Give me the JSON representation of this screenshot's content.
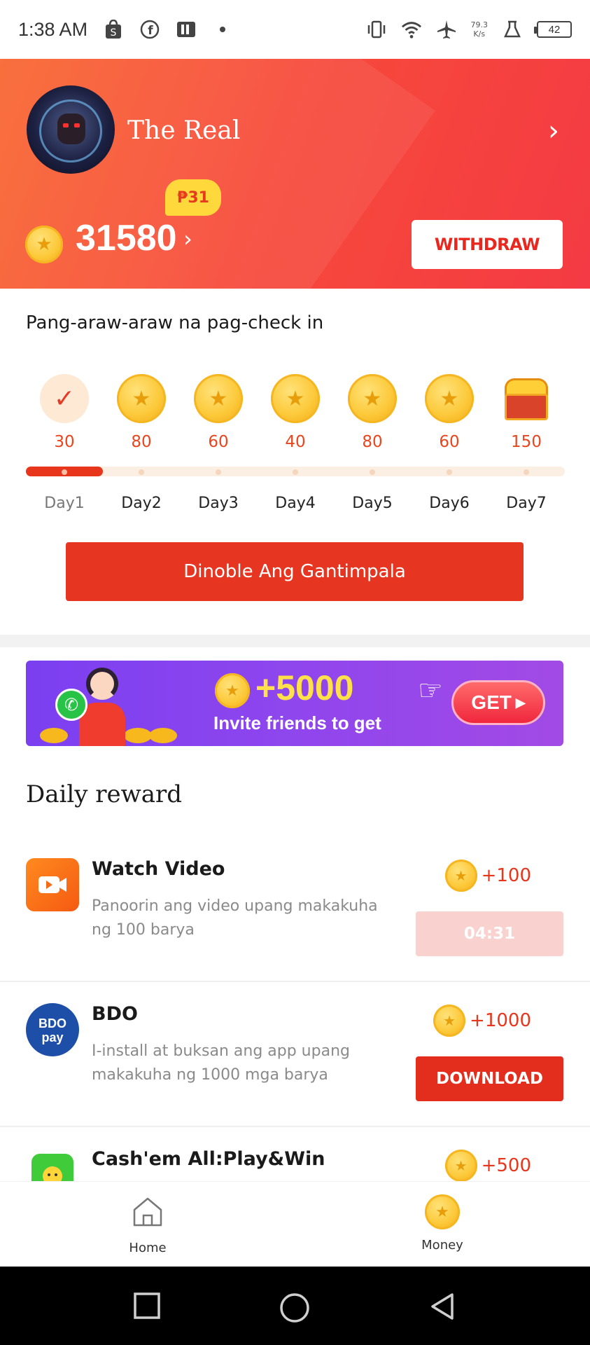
{
  "status_bar": {
    "time": "1:38 AM",
    "net_speed_value": "79.3",
    "net_speed_unit": "K/s",
    "battery": "42"
  },
  "profile": {
    "name": "The Real",
    "peso_badge": "₱31",
    "coin_balance": "31580",
    "withdraw_label": "WITHDRAW"
  },
  "checkin": {
    "title": "Pang-araw-araw na pag-check in",
    "days": [
      {
        "label": "Day1",
        "value": "30",
        "state": "checked"
      },
      {
        "label": "Day2",
        "value": "80",
        "state": "coin"
      },
      {
        "label": "Day3",
        "value": "60",
        "state": "coin"
      },
      {
        "label": "Day4",
        "value": "40",
        "state": "coin"
      },
      {
        "label": "Day5",
        "value": "80",
        "state": "coin"
      },
      {
        "label": "Day6",
        "value": "60",
        "state": "coin"
      },
      {
        "label": "Day7",
        "value": "150",
        "state": "chest"
      }
    ],
    "progress_fraction": 0.143,
    "double_button_label": "Dinoble Ang Gantimpala"
  },
  "invite_banner": {
    "amount": "+5000",
    "text": "Invite friends to get",
    "button_label": "GET"
  },
  "daily_reward": {
    "title": "Daily reward",
    "items": [
      {
        "name": "Watch Video",
        "description": "Panoorin ang video upang makakuha ng 100 barya",
        "reward": "+100",
        "button_label": "04:31",
        "button_state": "disabled",
        "icon": "video-icon"
      },
      {
        "name": "BDO",
        "description": "I-install at buksan ang app upang makakuha ng 1000 mga barya",
        "reward": "+1000",
        "button_label": "DOWNLOAD",
        "button_state": "primary",
        "icon": "bdo-pay-icon"
      },
      {
        "name": "Cash'em All:Play&Win",
        "description": "",
        "reward": "+500",
        "icon": "cashem-all-icon"
      }
    ]
  },
  "bottom_nav": {
    "home_label": "Home",
    "money_label": "Money"
  },
  "colors": {
    "accent_red": "#e63622",
    "header_orange": "#f9652f",
    "coin_gold": "#fcc93a",
    "banner_purple": "#8b45ee"
  }
}
